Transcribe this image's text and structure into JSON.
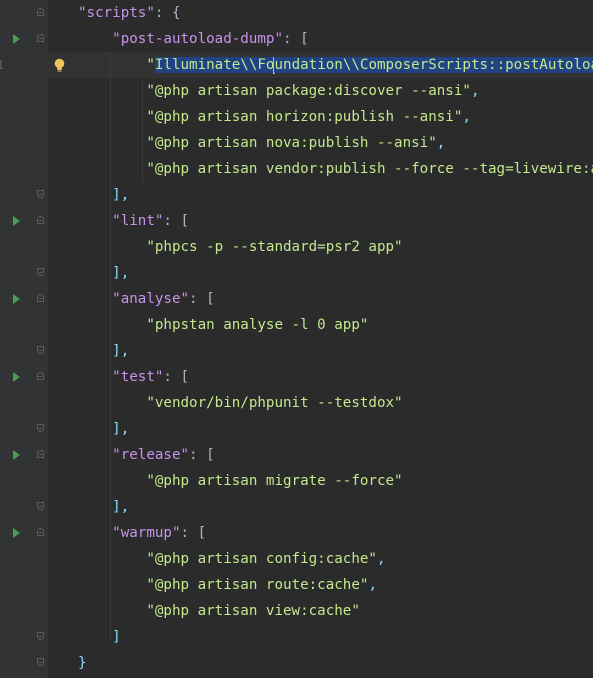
{
  "editor": {
    "lines": [
      {
        "num": "",
        "indent": "",
        "key": "\"scripts\"",
        "after": ": {",
        "value": "",
        "tail": "",
        "run": false,
        "fold": "start"
      },
      {
        "num": "",
        "indent": "    ",
        "key": "\"post-autoload-dump\"",
        "after": ": [",
        "value": "",
        "tail": "",
        "run": true,
        "fold": "start"
      },
      {
        "num": "1",
        "indent": "        ",
        "key": "",
        "after": "",
        "value": "",
        "tail": "",
        "run": false,
        "fold": "",
        "special": true
      },
      {
        "num": "",
        "indent": "        ",
        "key": "",
        "after": "",
        "value": "\"@php artisan package:discover --ansi\"",
        "tail": ",",
        "run": false,
        "fold": ""
      },
      {
        "num": "",
        "indent": "        ",
        "key": "",
        "after": "",
        "value": "\"@php artisan horizon:publish --ansi\"",
        "tail": ",",
        "run": false,
        "fold": ""
      },
      {
        "num": "",
        "indent": "        ",
        "key": "",
        "after": "",
        "value": "\"@php artisan nova:publish --ansi\"",
        "tail": ",",
        "run": false,
        "fold": ""
      },
      {
        "num": "",
        "indent": "        ",
        "key": "",
        "after": "",
        "value": "\"@php artisan vendor:publish --force --tag=livewire:assets --ansi\"",
        "tail": "",
        "run": false,
        "fold": ""
      },
      {
        "num": "",
        "indent": "    ",
        "key": "",
        "after": "],",
        "value": "",
        "tail": "",
        "run": false,
        "fold": "end"
      },
      {
        "num": "",
        "indent": "    ",
        "key": "\"lint\"",
        "after": ": [",
        "value": "",
        "tail": "",
        "run": true,
        "fold": "start"
      },
      {
        "num": "",
        "indent": "        ",
        "key": "",
        "after": "",
        "value": "\"phpcs -p --standard=psr2 app\"",
        "tail": "",
        "run": false,
        "fold": ""
      },
      {
        "num": "",
        "indent": "    ",
        "key": "",
        "after": "],",
        "value": "",
        "tail": "",
        "run": false,
        "fold": "end"
      },
      {
        "num": "",
        "indent": "    ",
        "key": "\"analyse\"",
        "after": ": [",
        "value": "",
        "tail": "",
        "run": true,
        "fold": "start"
      },
      {
        "num": "",
        "indent": "        ",
        "key": "",
        "after": "",
        "value": "\"phpstan analyse -l 0 app\"",
        "tail": "",
        "run": false,
        "fold": ""
      },
      {
        "num": "",
        "indent": "    ",
        "key": "",
        "after": "],",
        "value": "",
        "tail": "",
        "run": false,
        "fold": "end"
      },
      {
        "num": "",
        "indent": "    ",
        "key": "\"test\"",
        "after": ": [",
        "value": "",
        "tail": "",
        "run": true,
        "fold": "start"
      },
      {
        "num": "",
        "indent": "        ",
        "key": "",
        "after": "",
        "value": "\"vendor/bin/phpunit --testdox\"",
        "tail": "",
        "run": false,
        "fold": ""
      },
      {
        "num": "",
        "indent": "    ",
        "key": "",
        "after": "],",
        "value": "",
        "tail": "",
        "run": false,
        "fold": "end"
      },
      {
        "num": "",
        "indent": "    ",
        "key": "\"release\"",
        "after": ": [",
        "value": "",
        "tail": "",
        "run": true,
        "fold": "start"
      },
      {
        "num": "",
        "indent": "        ",
        "key": "",
        "after": "",
        "value": "\"@php artisan migrate --force\"",
        "tail": "",
        "run": false,
        "fold": ""
      },
      {
        "num": "",
        "indent": "    ",
        "key": "",
        "after": "],",
        "value": "",
        "tail": "",
        "run": false,
        "fold": "end"
      },
      {
        "num": "",
        "indent": "    ",
        "key": "\"warmup\"",
        "after": ": [",
        "value": "",
        "tail": "",
        "run": true,
        "fold": "start"
      },
      {
        "num": "",
        "indent": "        ",
        "key": "",
        "after": "",
        "value": "\"@php artisan config:cache\"",
        "tail": ",",
        "run": false,
        "fold": ""
      },
      {
        "num": "",
        "indent": "        ",
        "key": "",
        "after": "",
        "value": "\"@php artisan route:cache\"",
        "tail": ",",
        "run": false,
        "fold": ""
      },
      {
        "num": "",
        "indent": "        ",
        "key": "",
        "after": "",
        "value": "\"@php artisan view:cache\"",
        "tail": "",
        "run": false,
        "fold": ""
      },
      {
        "num": "",
        "indent": "    ",
        "key": "",
        "after": "]",
        "value": "",
        "tail": "",
        "run": false,
        "fold": "end"
      },
      {
        "num": "",
        "indent": "",
        "key": "",
        "after": "}",
        "value": "",
        "tail": "",
        "run": false,
        "fold": "end"
      }
    ],
    "current_line": {
      "quote_open": "\"",
      "selected_before_caret": "Illuminate\\\\Fo",
      "selected_after_caret": "undation\\\\ComposerScripts::postAutoloadDump\"",
      "tail": ","
    },
    "icons": {
      "run": "run-gutter-icon",
      "fold": "fold-gutter-icon",
      "intention": "lightbulb-icon"
    },
    "colors": {
      "background": "#2b2b2b",
      "gutter": "#313335",
      "key": "#c792ea",
      "string": "#c3e88d",
      "punctuation": "#89ddff",
      "selection": "#214283",
      "run_icon": "#499c54",
      "bulb": "#f2c55c"
    }
  }
}
